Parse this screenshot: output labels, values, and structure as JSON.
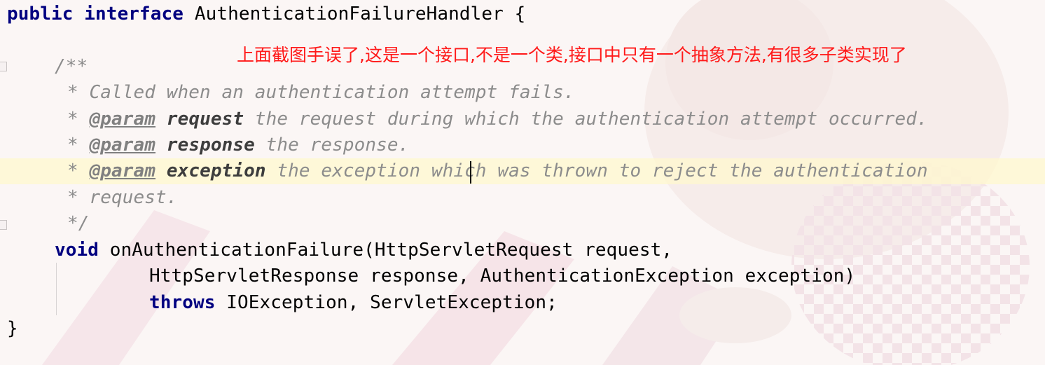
{
  "code": {
    "line1": {
      "kw": "public interface",
      "name": " AuthenticationFailureHandler {"
    },
    "line3": "/**",
    "line4": "* Called when an authentication attempt fails.",
    "line5": {
      "star": "* ",
      "tag": "@param",
      "param": "request",
      "text": " the request during which the authentication attempt occurred."
    },
    "line6": {
      "star": "* ",
      "tag": "@param",
      "param": "response",
      "text": " the response."
    },
    "line7": {
      "star": "* ",
      "tag": "@param",
      "param": "exception",
      "text": " the exception which was thrown to reject the authentication"
    },
    "line8": "* request.",
    "line9": "*/",
    "line10": {
      "kw": "void",
      "text": " onAuthenticationFailure(HttpServletRequest request,"
    },
    "line11": "HttpServletResponse response, AuthenticationException exception)",
    "line12": {
      "kw": "throws",
      "text": " IOException, ServletException;"
    },
    "line13": "}"
  },
  "annotation": "上面截图手误了,这是一个接口,不是一个类,接口中只有一个抽象方法,有很多子类实现了",
  "colors": {
    "keyword": "#000080",
    "doc_comment": "#8c8c8c",
    "annotation_text": "#ff1a1a",
    "caret_line": "#fff8cd"
  }
}
